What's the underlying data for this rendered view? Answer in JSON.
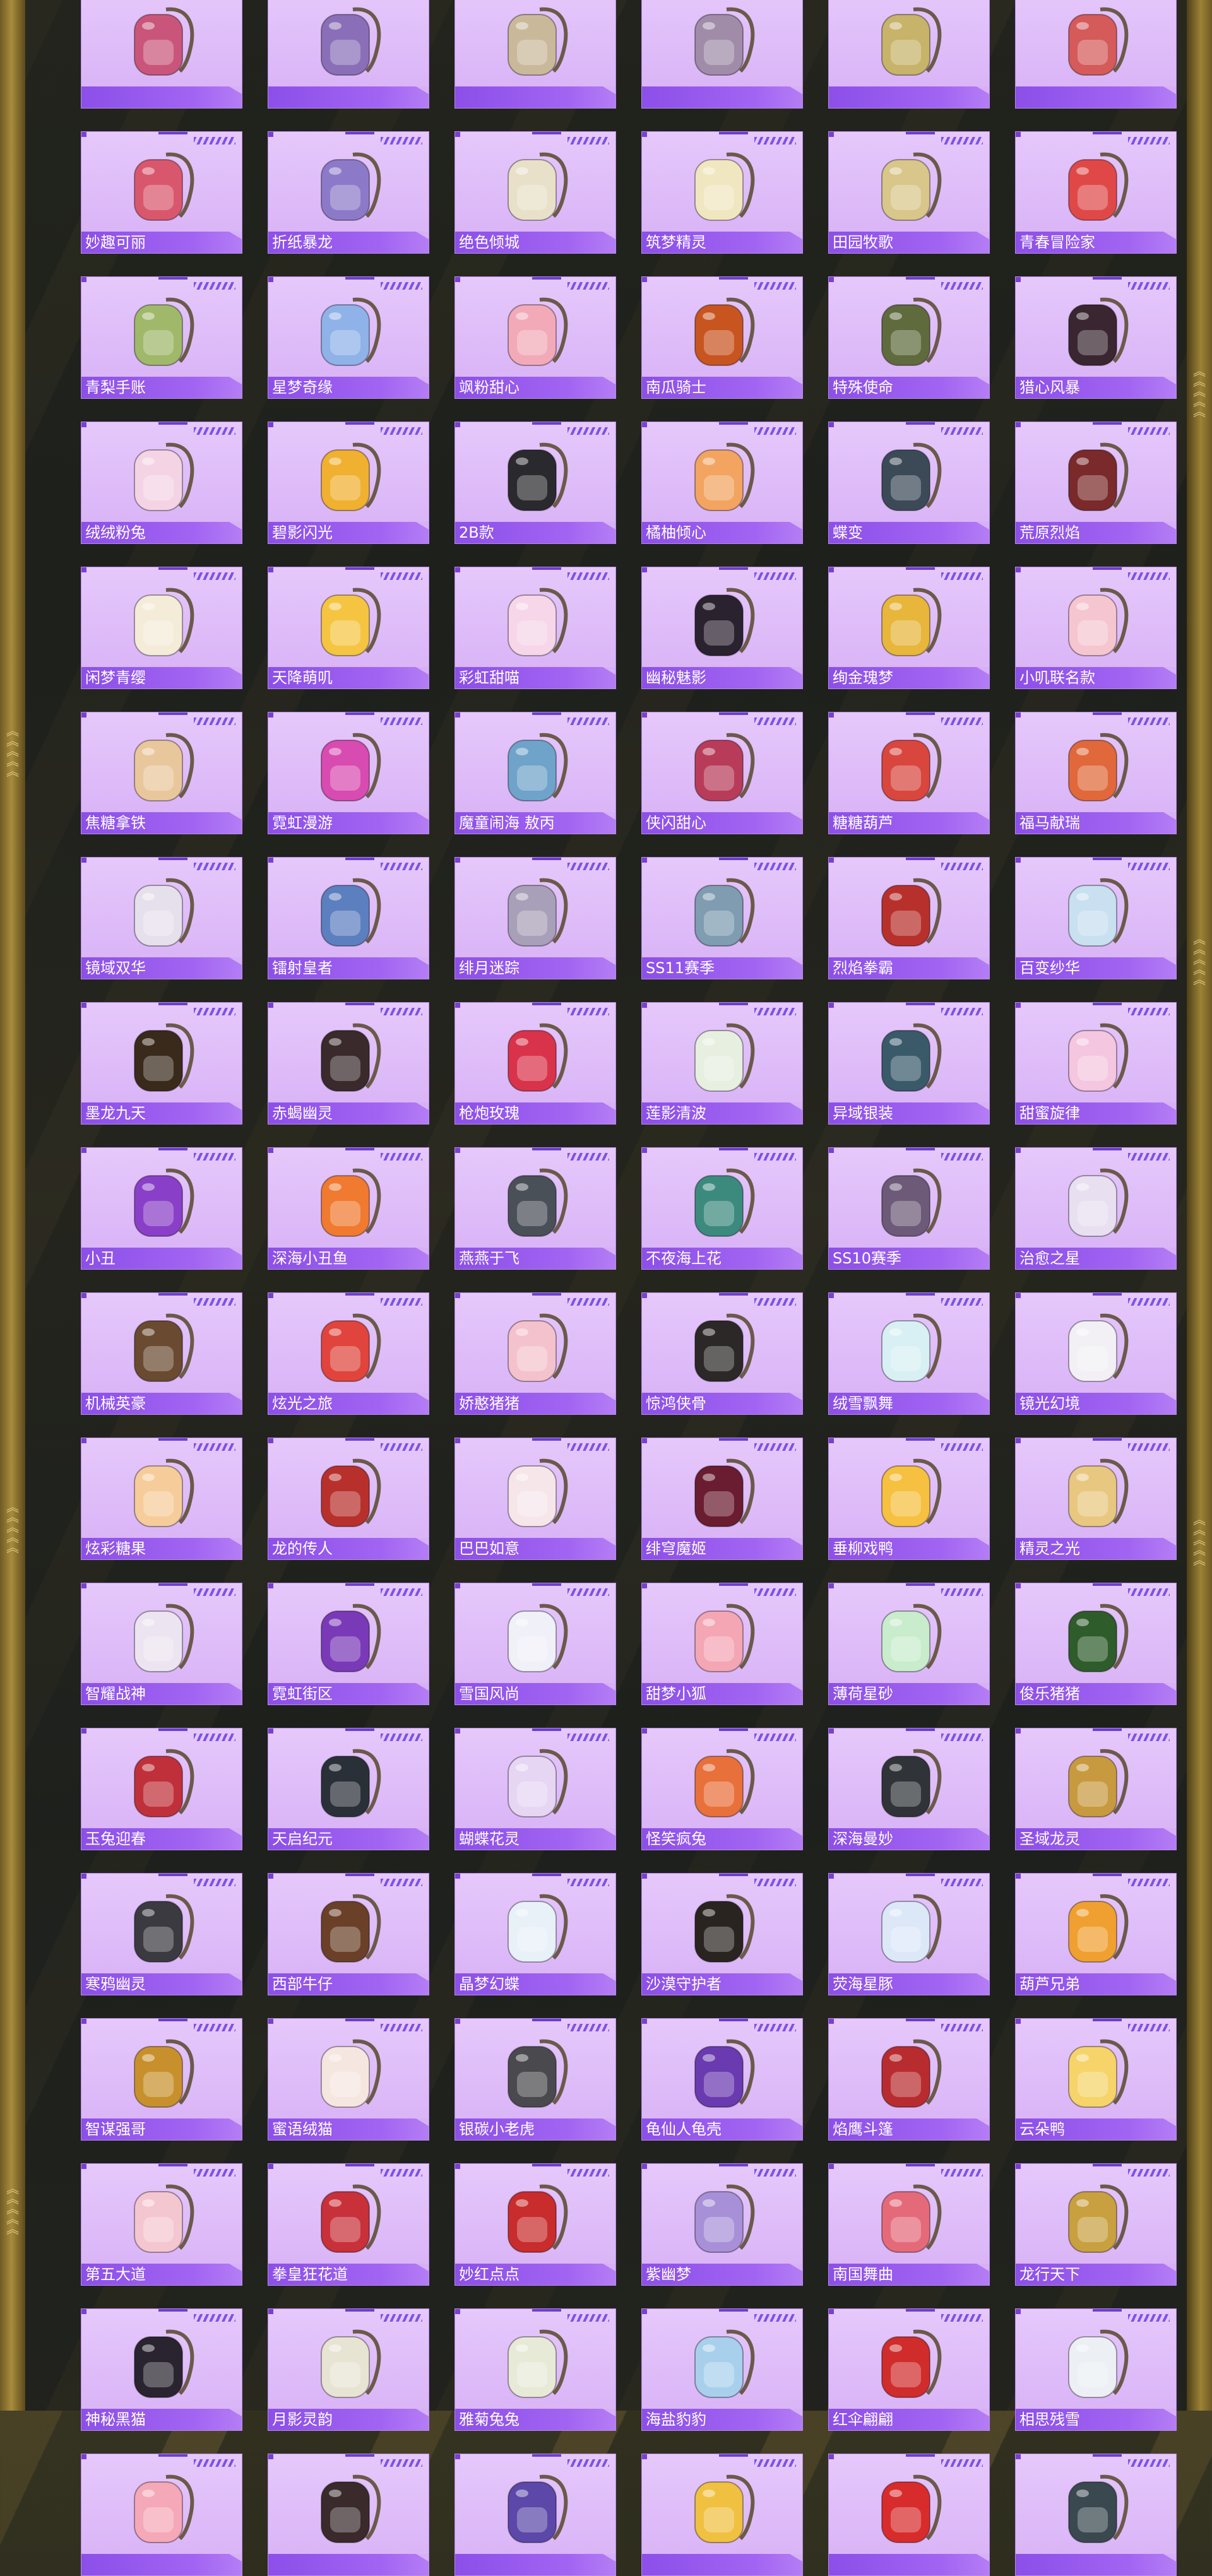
{
  "items": [
    {
      "label": "",
      "color": "#c9567a"
    },
    {
      "label": "",
      "color": "#8a6fb8"
    },
    {
      "label": "",
      "color": "#c9b99a"
    },
    {
      "label": "",
      "color": "#a08ca8"
    },
    {
      "label": "",
      "color": "#c7b36a"
    },
    {
      "label": "",
      "color": "#d55a5a"
    },
    {
      "label": "妙趣可丽",
      "color": "#d9576d"
    },
    {
      "label": "折纸暴龙",
      "color": "#8c7ac9"
    },
    {
      "label": "绝色倾城",
      "color": "#e8e0c8"
    },
    {
      "label": "筑梦精灵",
      "color": "#f0e6c0"
    },
    {
      "label": "田园牧歌",
      "color": "#d8c68a"
    },
    {
      "label": "青春冒险家",
      "color": "#e04848"
    },
    {
      "label": "青梨手账",
      "color": "#9fb86a"
    },
    {
      "label": "星梦奇缘",
      "color": "#8fb2e8"
    },
    {
      "label": "飒粉甜心",
      "color": "#f2a9b8"
    },
    {
      "label": "南瓜骑士",
      "color": "#c8541f"
    },
    {
      "label": "特殊使命",
      "color": "#5f6b3c"
    },
    {
      "label": "猎心风暴",
      "color": "#3a2630"
    },
    {
      "label": "绒绒粉兔",
      "color": "#f4d4e4"
    },
    {
      "label": "碧影闪光",
      "color": "#f0b030"
    },
    {
      "label": "2B款",
      "color": "#2a2a2e"
    },
    {
      "label": "橘柚倾心",
      "color": "#f2a460"
    },
    {
      "label": "蝶变",
      "color": "#3c4a58"
    },
    {
      "label": "荒原烈焰",
      "color": "#7a2a2a"
    },
    {
      "label": "闲梦青缨",
      "color": "#f4ecd8"
    },
    {
      "label": "天降萌叽",
      "color": "#f5c542"
    },
    {
      "label": "彩虹甜喵",
      "color": "#f6d6e8"
    },
    {
      "label": "幽秘魅影",
      "color": "#2b2230"
    },
    {
      "label": "绚金瑰梦",
      "color": "#e7b63b"
    },
    {
      "label": "小叽联名款",
      "color": "#f6c6d0"
    },
    {
      "label": "焦糖拿铁",
      "color": "#e9c79c"
    },
    {
      "label": "霓虹漫游",
      "color": "#d84bb0"
    },
    {
      "label": "魔童闹海 敖丙",
      "color": "#6fa3c9"
    },
    {
      "label": "侠闪甜心",
      "color": "#b83c5a"
    },
    {
      "label": "糖糖葫芦",
      "color": "#d8463e"
    },
    {
      "label": "福马献瑞",
      "color": "#e0683a"
    },
    {
      "label": "镜域双华",
      "color": "#e6e0ec"
    },
    {
      "label": "镭射皇者",
      "color": "#5c7fc0"
    },
    {
      "label": "绯月迷踪",
      "color": "#a8a0b8"
    },
    {
      "label": "SS11赛季",
      "color": "#7f9cb0"
    },
    {
      "label": "烈焰拳霸",
      "color": "#b8302c"
    },
    {
      "label": "百变纱华",
      "color": "#c8e0f0"
    },
    {
      "label": "墨龙九天",
      "color": "#3a2a1c"
    },
    {
      "label": "赤蝎幽灵",
      "color": "#3a2a2c"
    },
    {
      "label": "枪炮玫瑰",
      "color": "#d8334a"
    },
    {
      "label": "莲影清波",
      "color": "#e6efe0"
    },
    {
      "label": "异域银装",
      "color": "#3a5a6a"
    },
    {
      "label": "甜蜜旋律",
      "color": "#f4c6e0"
    },
    {
      "label": "小丑",
      "color": "#8a3fc8"
    },
    {
      "label": "深海小丑鱼",
      "color": "#f07a30"
    },
    {
      "label": "燕燕于飞",
      "color": "#4a5058"
    },
    {
      "label": "不夜海上花",
      "color": "#3c8a7e"
    },
    {
      "label": "SS10赛季",
      "color": "#6c5a78"
    },
    {
      "label": "治愈之星",
      "color": "#e8e0f0"
    },
    {
      "label": "机械英豪",
      "color": "#6a4a30"
    },
    {
      "label": "炫光之旅",
      "color": "#e0443c"
    },
    {
      "label": "娇憨猪猪",
      "color": "#f4c2cc"
    },
    {
      "label": "惊鸿侠骨",
      "color": "#2c2828"
    },
    {
      "label": "绒雪飘舞",
      "color": "#d8f0f4"
    },
    {
      "label": "镜光幻境",
      "color": "#f2f0f4"
    },
    {
      "label": "炫彩糖果",
      "color": "#f6cc9a"
    },
    {
      "label": "龙的传人",
      "color": "#b8302c"
    },
    {
      "label": "巴巴如意",
      "color": "#f6e6ea"
    },
    {
      "label": "绯穹魔姬",
      "color": "#6a1c30"
    },
    {
      "label": "垂柳戏鸭",
      "color": "#f6c040"
    },
    {
      "label": "精灵之光",
      "color": "#e8c880"
    },
    {
      "label": "智耀战神",
      "color": "#ece4f0"
    },
    {
      "label": "霓虹街区",
      "color": "#7a3ab8"
    },
    {
      "label": "雪国风尚",
      "color": "#f0f0f8"
    },
    {
      "label": "甜梦小狐",
      "color": "#f4a6b4"
    },
    {
      "label": "薄荷星砂",
      "color": "#c8eccc"
    },
    {
      "label": "俊乐猪猪",
      "color": "#2e5c2a"
    },
    {
      "label": "玉兔迎春",
      "color": "#c0303a"
    },
    {
      "label": "天启纪元",
      "color": "#2a3038"
    },
    {
      "label": "蝴蝶花灵",
      "color": "#e6d6f4"
    },
    {
      "label": "怪笑疯兔",
      "color": "#e8703a"
    },
    {
      "label": "深海曼妙",
      "color": "#303438"
    },
    {
      "label": "圣域龙灵",
      "color": "#c89a40"
    },
    {
      "label": "寒鸦幽灵",
      "color": "#3a3a40"
    },
    {
      "label": "西部牛仔",
      "color": "#6a4028"
    },
    {
      "label": "晶梦幻蝶",
      "color": "#e8f0f8"
    },
    {
      "label": "沙漠守护者",
      "color": "#2a2420"
    },
    {
      "label": "荧海星豚",
      "color": "#dce8f8"
    },
    {
      "label": "葫芦兄弟",
      "color": "#f0a030"
    },
    {
      "label": "智谋强哥",
      "color": "#c8902c"
    },
    {
      "label": "蜜语绒猫",
      "color": "#f6e6e0"
    },
    {
      "label": "银碳小老虎",
      "color": "#4a4a4e"
    },
    {
      "label": "龟仙人龟壳",
      "color": "#6a3ab0"
    },
    {
      "label": "焰鹰斗篷",
      "color": "#b82c30"
    },
    {
      "label": "云朵鸭",
      "color": "#f6d46a"
    },
    {
      "label": "第五大道",
      "color": "#f4c6d0"
    },
    {
      "label": "拳皇狂花道",
      "color": "#c8303a"
    },
    {
      "label": "妙红点点",
      "color": "#c82c2c"
    },
    {
      "label": "紫幽梦",
      "color": "#a890d8"
    },
    {
      "label": "南国舞曲",
      "color": "#e46a7a"
    },
    {
      "label": "龙行天下",
      "color": "#c8a040"
    },
    {
      "label": "神秘黑猫",
      "color": "#2a2430"
    },
    {
      "label": "月影灵韵",
      "color": "#e8e4d4"
    },
    {
      "label": "雅菊兔兔",
      "color": "#e8ead8"
    },
    {
      "label": "海盐豹豹",
      "color": "#a8d0ec"
    },
    {
      "label": "红伞翩翩",
      "color": "#d02c2c"
    },
    {
      "label": "相思残雪",
      "color": "#ecf0f4"
    },
    {
      "label": "",
      "color": "#f4a8b8"
    },
    {
      "label": "",
      "color": "#3a2a2c"
    },
    {
      "label": "",
      "color": "#5c48a8"
    },
    {
      "label": "",
      "color": "#f0c040"
    },
    {
      "label": "",
      "color": "#d82c2c"
    },
    {
      "label": "",
      "color": "#3a4850"
    }
  ]
}
